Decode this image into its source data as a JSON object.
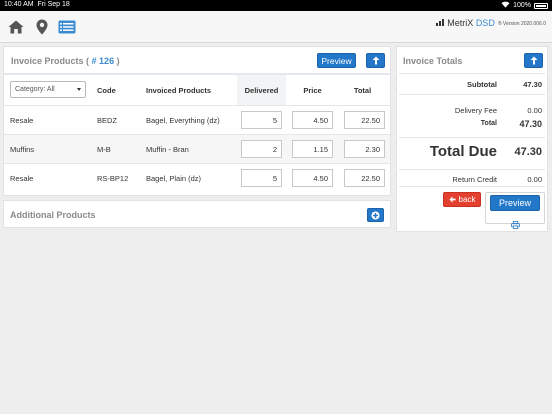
{
  "status_bar": {
    "time": "10:40 AM",
    "date": "Fri Sep 18",
    "battery": "100%"
  },
  "brand": {
    "name_prefix": "MetriX ",
    "name_suffix": "DSD",
    "version": "® Version 2020.006.0"
  },
  "nav": {
    "icons": [
      "home-icon",
      "map-pin-icon",
      "invoice-list-icon"
    ]
  },
  "invoice_products": {
    "title": "Invoice Products (",
    "number": "# 126",
    "title_close": ")",
    "preview_label": "Preview",
    "category_select": "Category: All",
    "columns": [
      "Code",
      "Invoiced Products",
      "Delivered",
      "Price",
      "Total"
    ],
    "rows": [
      {
        "category": "Resale",
        "code": "BEDZ",
        "product": "Bagel, Everything (dz)",
        "delivered": "5",
        "price": "4.50",
        "total": "22.50"
      },
      {
        "category": "Muffins",
        "code": "M-B",
        "product": "Muffin - Bran",
        "delivered": "2",
        "price": "1.15",
        "total": "2.30"
      },
      {
        "category": "Resale",
        "code": "RS-BP12",
        "product": "Bagel, Plain (dz)",
        "delivered": "5",
        "price": "4.50",
        "total": "22.50"
      }
    ]
  },
  "additional_products": {
    "title": "Additional Products"
  },
  "invoice_totals": {
    "title": "Invoice Totals",
    "subtotal_label": "Subtotal",
    "subtotal": "47.30",
    "delivery_fee_label": "Delivery Fee",
    "delivery_fee": "0.00",
    "total_label": "Total",
    "total": "47.30",
    "total_due_label": "Total Due",
    "total_due": "47.30",
    "return_credit_label": "Return Credit",
    "return_credit": "0.00",
    "back_label": "back",
    "preview_label": "Preview"
  },
  "colors": {
    "accent": "#2277c8",
    "danger": "#e4402f",
    "link": "#3b8bd0"
  }
}
